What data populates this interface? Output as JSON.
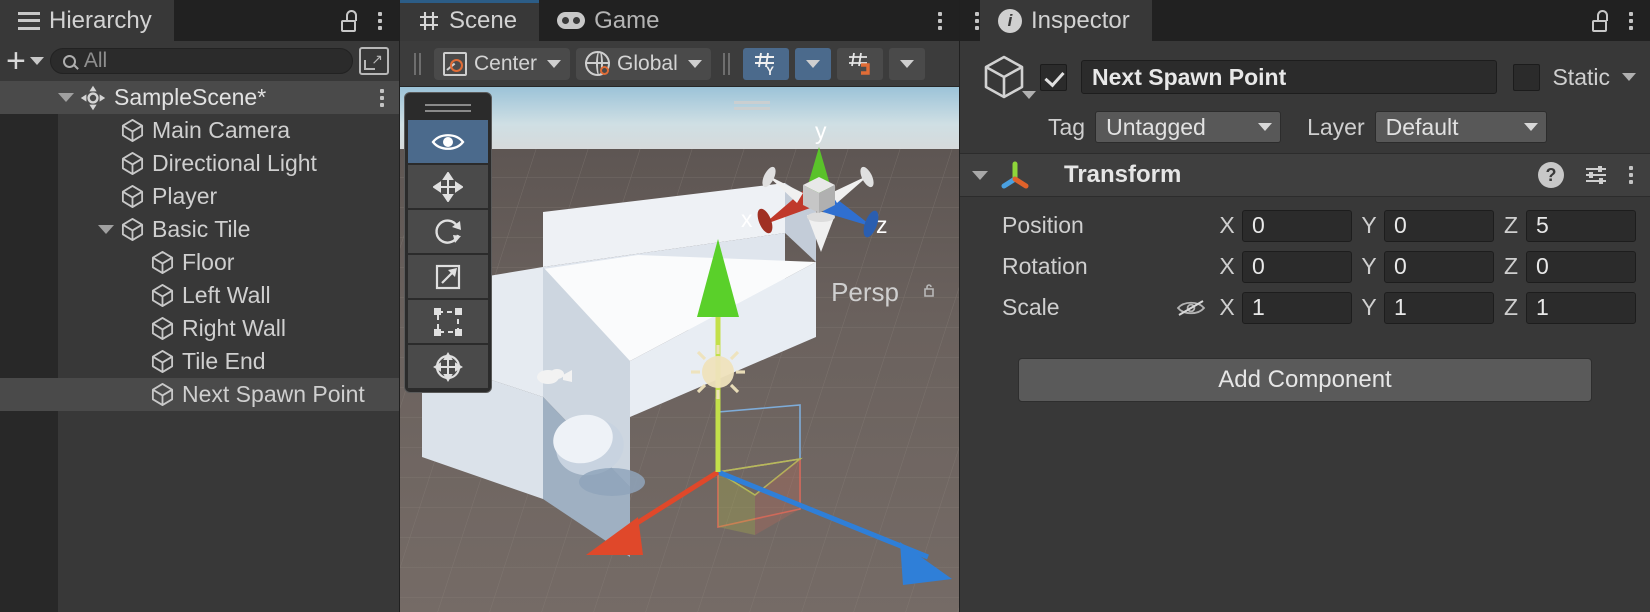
{
  "hierarchy": {
    "tab_label": "Hierarchy",
    "tab_icon": "list-icon",
    "lock_icon": "lock-open-icon",
    "menu_icon": "kebab-menu-icon",
    "add_label": "+",
    "search_placeholder": "All",
    "search_value": "",
    "popout_icon": "popout-icon",
    "scene_root": {
      "label": "SampleScene*",
      "icon": "unity-scene-icon",
      "expanded": true
    },
    "items": [
      {
        "label": "Main Camera",
        "depth": 1,
        "expandable": false,
        "selected": false
      },
      {
        "label": "Directional Light",
        "depth": 1,
        "expandable": false,
        "selected": false
      },
      {
        "label": "Player",
        "depth": 1,
        "expandable": false,
        "selected": false
      },
      {
        "label": "Basic Tile",
        "depth": 1,
        "expandable": true,
        "selected": false
      },
      {
        "label": "Floor",
        "depth": 2,
        "expandable": false,
        "selected": false
      },
      {
        "label": "Left Wall",
        "depth": 2,
        "expandable": false,
        "selected": false
      },
      {
        "label": "Right Wall",
        "depth": 2,
        "expandable": false,
        "selected": false
      },
      {
        "label": "Tile End",
        "depth": 2,
        "expandable": false,
        "selected": false
      },
      {
        "label": "Next Spawn Point",
        "depth": 2,
        "expandable": false,
        "selected": true
      }
    ]
  },
  "scene": {
    "tabs": [
      {
        "label": "Scene",
        "icon": "grid-hash-icon",
        "active": true
      },
      {
        "label": "Game",
        "icon": "gamepad-icon",
        "active": false
      }
    ],
    "menu_icon": "kebab-menu-icon",
    "toolbar": {
      "pivot_label": "Center",
      "pivot_icon": "pivot-center-icon",
      "handle_label": "Global",
      "handle_icon": "globe-icon",
      "grid_axis_label": "Y",
      "grid_icon": "grid-y-icon",
      "grid_dropdown_icon": "chevron-down-icon",
      "snap_icon": "grid-snap-magnet-icon"
    },
    "tools": [
      {
        "name": "view-tool",
        "icon": "eye-icon",
        "active": true
      },
      {
        "name": "move-tool",
        "icon": "move-arrows-icon",
        "active": false
      },
      {
        "name": "rotate-tool",
        "icon": "rotate-icon",
        "active": false
      },
      {
        "name": "scale-tool",
        "icon": "scale-icon",
        "active": false
      },
      {
        "name": "rect-tool",
        "icon": "rect-transform-icon",
        "active": false
      },
      {
        "name": "transform-tool",
        "icon": "transform-icon",
        "active": false
      }
    ],
    "gizmo": {
      "x_label": "x",
      "y_label": "y",
      "z_label": "z",
      "x_color": "#c0392b",
      "y_color": "#5ac22a",
      "z_color": "#2f6fd0"
    },
    "projection_label": "Persp"
  },
  "inspector": {
    "tab_label": "Inspector",
    "tab_icon": "info-icon",
    "lock_icon": "lock-open-icon",
    "menu_icon": "kebab-menu-icon",
    "object_icon": "gameobject-cube-icon",
    "enabled": true,
    "name_value": "Next Spawn Point",
    "static_label": "Static",
    "static_checked": false,
    "tag_label": "Tag",
    "tag_value": "Untagged",
    "layer_label": "Layer",
    "layer_value": "Default",
    "component": {
      "title": "Transform",
      "icon": "transform-axis-icon",
      "expanded": true,
      "help_icon": "help-question-icon",
      "preset_icon": "preset-sliders-icon",
      "menu_icon": "kebab-menu-icon",
      "axis_labels": {
        "x": "X",
        "y": "Y",
        "z": "Z"
      },
      "rows": [
        {
          "label": "Position",
          "x": "0",
          "y": "0",
          "z": "5",
          "has_eye": false
        },
        {
          "label": "Rotation",
          "x": "0",
          "y": "0",
          "z": "0",
          "has_eye": false
        },
        {
          "label": "Scale",
          "x": "1",
          "y": "1",
          "z": "1",
          "has_eye": true,
          "eye_icon": "eye-off-icon"
        }
      ]
    },
    "add_component_label": "Add Component"
  },
  "colors": {
    "panel_bg": "#383838",
    "tabstrip_bg": "#212121",
    "selection": "#4a4a4a",
    "accent_blue": "#4b6a8c",
    "tab_underline": "#2c5d87",
    "field_bg": "#2b2b2b",
    "orange": "#e06c36"
  }
}
